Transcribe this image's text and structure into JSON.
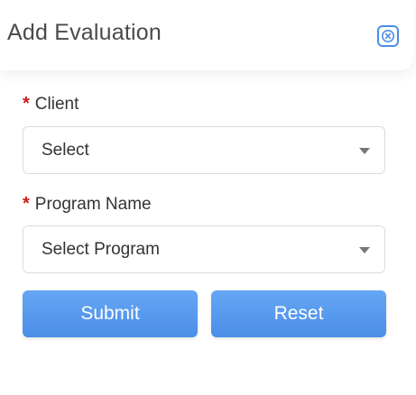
{
  "header": {
    "title": "Add Evaluation",
    "close_icon": "close-x-icon"
  },
  "form": {
    "client": {
      "required_mark": "*",
      "label": "Client",
      "value": "Select"
    },
    "program": {
      "required_mark": "*",
      "label": "Program Name",
      "value": "Select Program"
    }
  },
  "actions": {
    "submit_label": "Submit",
    "reset_label": "Reset"
  },
  "colors": {
    "accent": "#4a8fe6",
    "required": "#d01b1b"
  }
}
